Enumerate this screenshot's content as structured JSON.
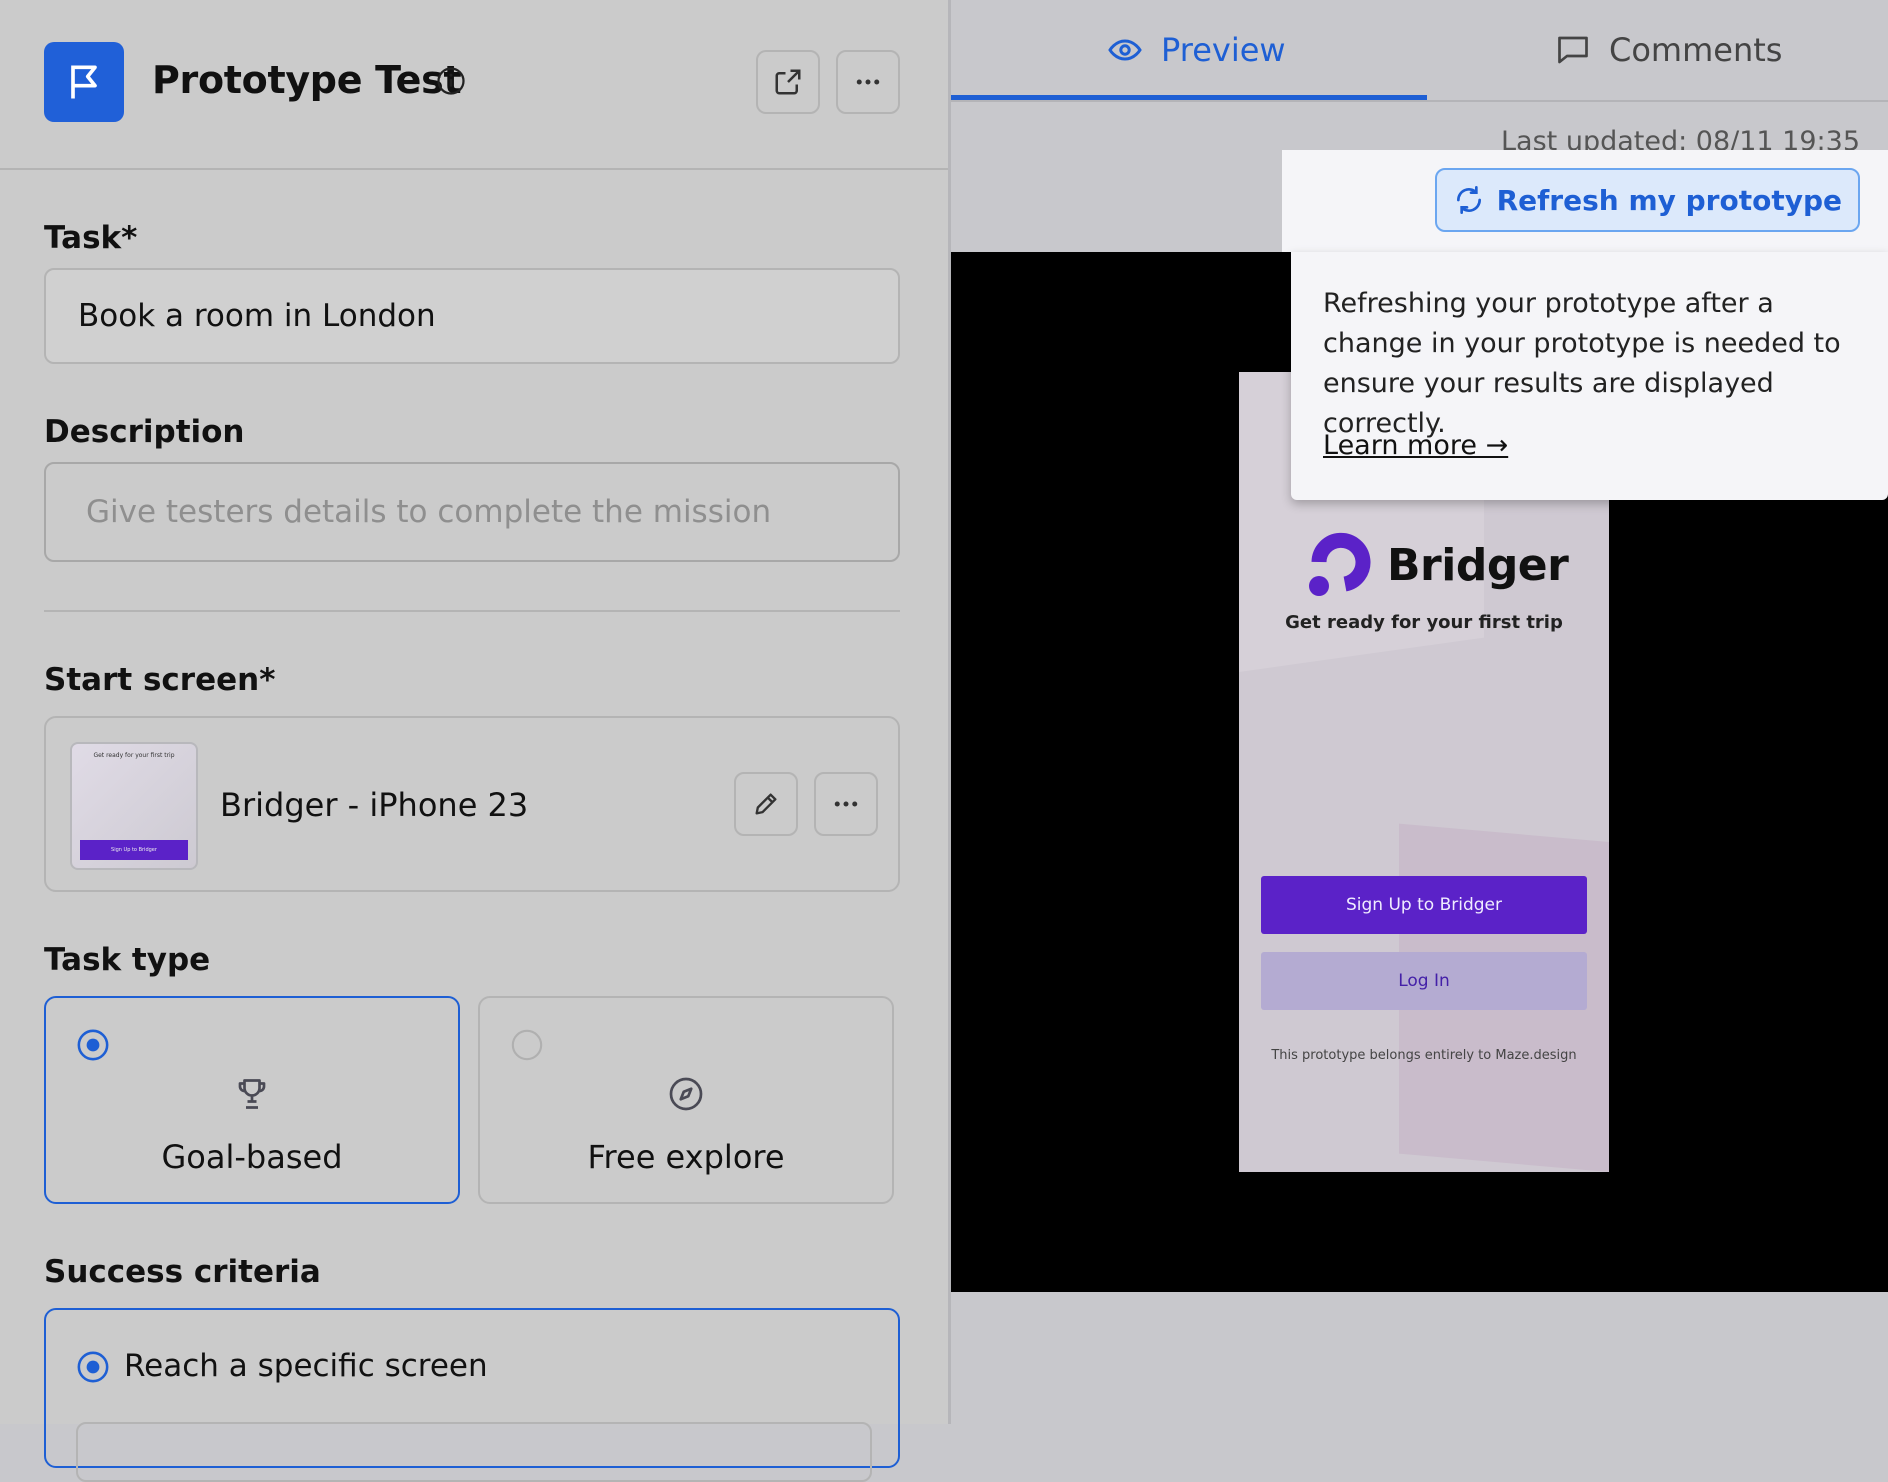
{
  "header": {
    "title": "Prototype Test"
  },
  "task": {
    "label": "Task*",
    "value": "Book a room in London"
  },
  "description": {
    "label": "Description",
    "placeholder": "Give testers details to complete the mission"
  },
  "start_screen": {
    "label": "Start screen*",
    "name": "Bridger - iPhone 23",
    "thumb_tagline": "Get ready for your first trip",
    "thumb_button": "Sign Up to Bridger"
  },
  "task_type": {
    "label": "Task type",
    "options": [
      {
        "label": "Goal-based",
        "selected": true
      },
      {
        "label": "Free explore",
        "selected": false
      }
    ]
  },
  "success_criteria": {
    "label": "Success criteria",
    "option": "Reach a specific screen"
  },
  "tabs": [
    {
      "label": "Preview",
      "active": true
    },
    {
      "label": "Comments",
      "active": false
    }
  ],
  "preview": {
    "last_updated": "Last updated: 08/11 19:35",
    "refresh_label": "Refresh my prototype",
    "tooltip_text": "Refreshing your prototype after a change in your prototype is needed to ensure your results are displayed correctly.",
    "learn_more": "Learn more →"
  },
  "prototype": {
    "brand": "Bridger",
    "tagline": "Get ready for your first trip",
    "signup": "Sign Up to Bridger",
    "login": "Log In",
    "footer": "This prototype belongs entirely to Maze.design"
  },
  "colors": {
    "accent": "#1e5fd4",
    "brand_purple": "#5b22c8",
    "login_bg": "#b4abd2"
  }
}
